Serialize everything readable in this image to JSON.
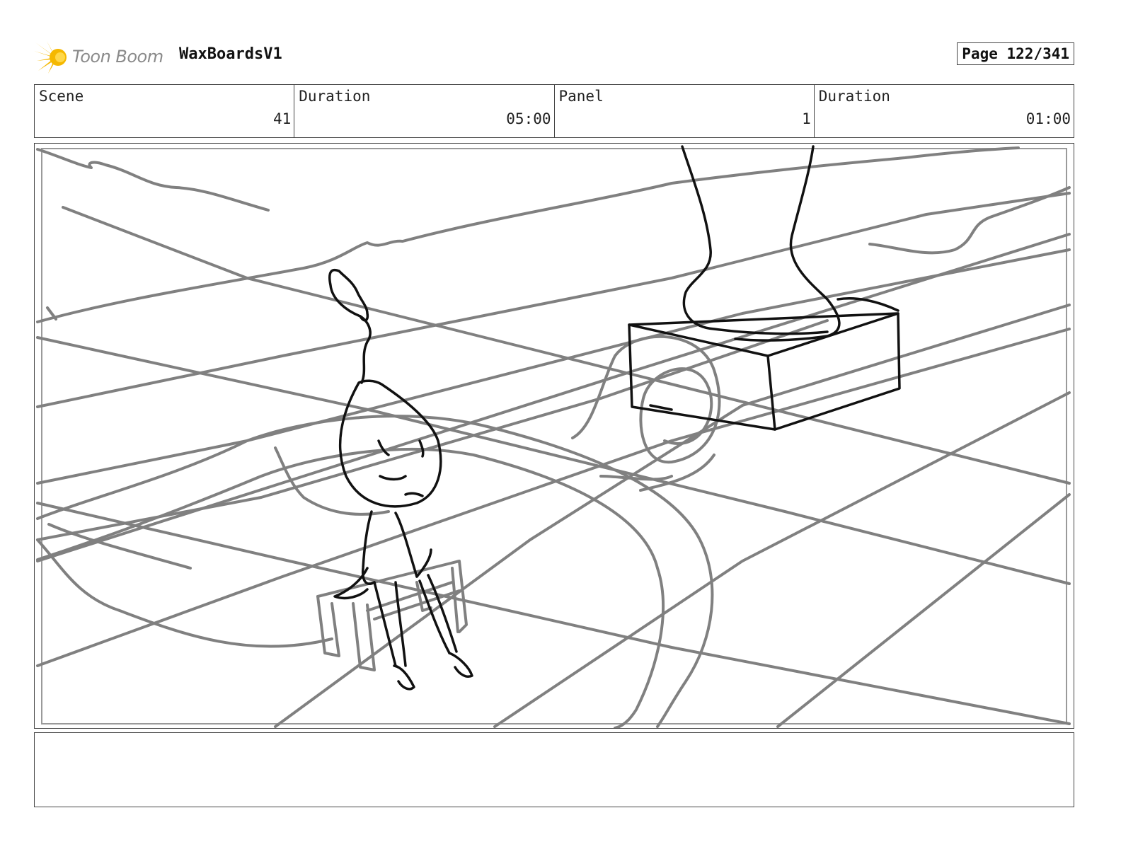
{
  "header": {
    "logo_text": "Toon Boom",
    "project_title": "WaxBoardsV1",
    "page_label": "Page 122/341"
  },
  "info": {
    "scene_label": "Scene",
    "scene_value": "41",
    "scene_duration_label": "Duration",
    "scene_duration_value": "05:00",
    "panel_label": "Panel",
    "panel_value": "1",
    "panel_duration_label": "Duration",
    "panel_duration_value": "01:00"
  },
  "notes": {
    "text": ""
  },
  "colors": {
    "logo_accent": "#f5b800",
    "sketch_background": "#808080",
    "sketch_character": "#111111"
  },
  "icons": {
    "logo": "toon-boom-star-icon"
  }
}
